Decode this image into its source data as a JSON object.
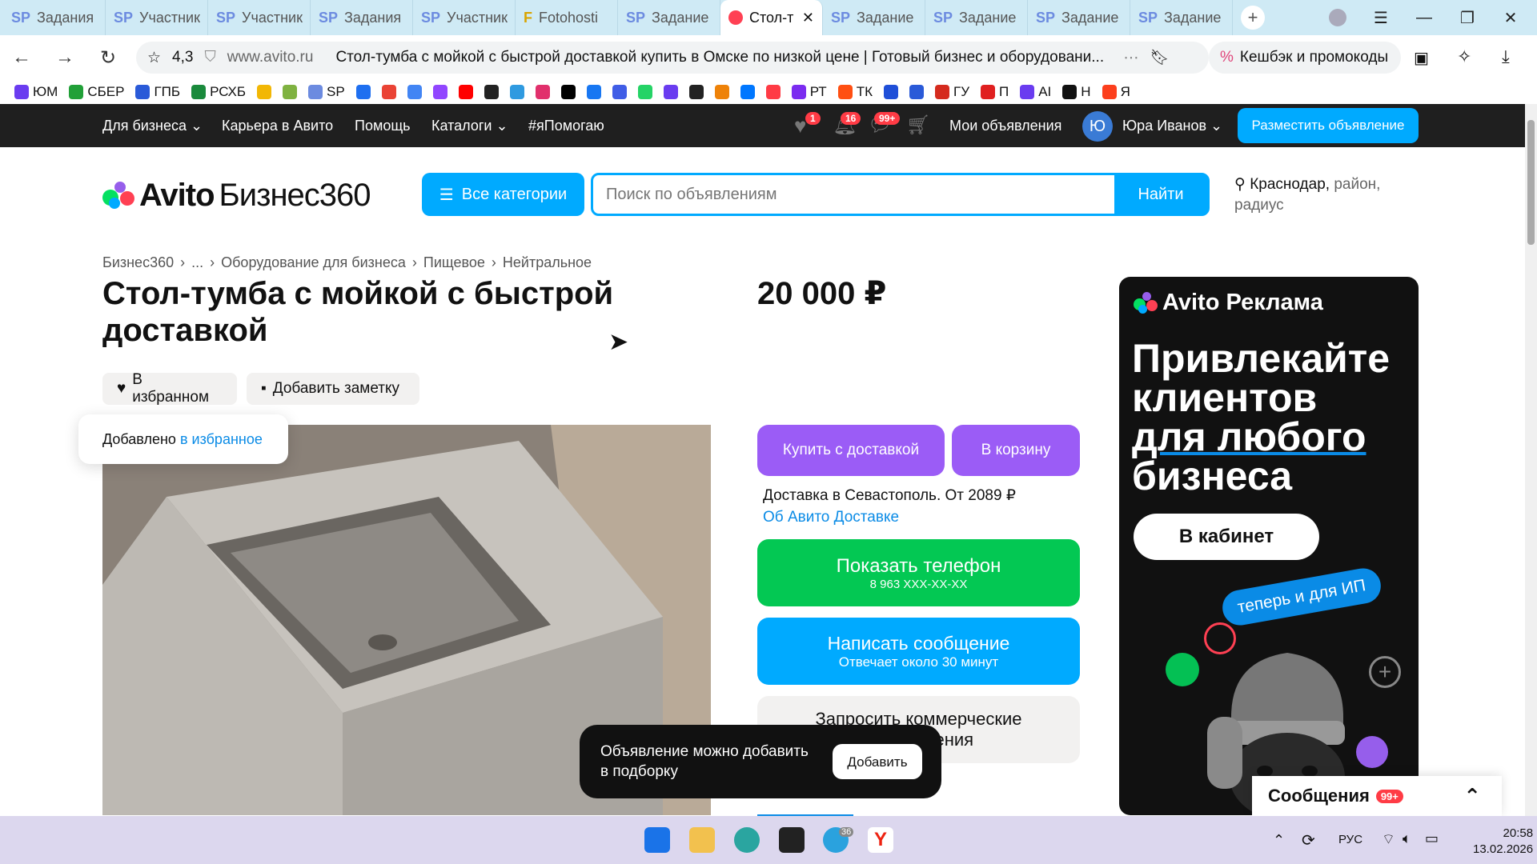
{
  "browser": {
    "tabs": [
      {
        "icon": "SP",
        "label": "Задания"
      },
      {
        "icon": "SP",
        "label": "Участник"
      },
      {
        "icon": "SP",
        "label": "Участник"
      },
      {
        "icon": "SP",
        "label": "Задания"
      },
      {
        "icon": "SP",
        "label": "Участник"
      },
      {
        "icon": "F",
        "label": "Fotohosti"
      },
      {
        "icon": "SP",
        "label": "Задание"
      },
      {
        "icon": "avito",
        "label": "Стол-т",
        "active": true
      },
      {
        "icon": "SP",
        "label": "Задание"
      },
      {
        "icon": "SP",
        "label": "Задание"
      },
      {
        "icon": "SP",
        "label": "Задание"
      },
      {
        "icon": "SP",
        "label": "Задание"
      }
    ],
    "rating": "4,3",
    "host": "www.avito.ru",
    "page_title": "Стол-тумба с мойкой с быстрой доставкой купить в Омске по низкой цене | Готовый бизнес и оборудовани...",
    "cashback": "Кешбэк и промокоды",
    "bookmarks": [
      {
        "label": "ЮМ",
        "color": "#6a3cf0"
      },
      {
        "label": "СБЕР",
        "color": "#21a038"
      },
      {
        "label": "ГПБ",
        "color": "#2a5ad8"
      },
      {
        "label": "РСХБ",
        "color": "#1a8a3c"
      },
      {
        "label": "",
        "color": "#f2b705"
      },
      {
        "label": "",
        "color": "#7fb241"
      },
      {
        "label": "SP",
        "color": "#6c8be0"
      },
      {
        "label": "",
        "color": "#1e6ff0"
      },
      {
        "label": "",
        "color": "#ea4335"
      },
      {
        "label": "",
        "color": "#4285f4"
      },
      {
        "label": "",
        "color": "#9146ff"
      },
      {
        "label": "",
        "color": "#ff0000"
      },
      {
        "label": "",
        "color": "#222222"
      },
      {
        "label": "",
        "color": "#2f9ae0"
      },
      {
        "label": "",
        "color": "#e1306c"
      },
      {
        "label": "",
        "color": "#000000"
      },
      {
        "label": "",
        "color": "#1877f2"
      },
      {
        "label": "",
        "color": "#405de6"
      },
      {
        "label": "",
        "color": "#25d366"
      },
      {
        "label": "",
        "color": "#6a3cf0"
      },
      {
        "label": "",
        "color": "#222222"
      },
      {
        "label": "",
        "color": "#ee8208"
      },
      {
        "label": "",
        "color": "#0077ff"
      },
      {
        "label": "",
        "color": "#ff3b45"
      },
      {
        "label": "РТ",
        "color": "#7b2cf0"
      },
      {
        "label": "ТК",
        "color": "#ff4f12"
      },
      {
        "label": "",
        "color": "#1f4fd8"
      },
      {
        "label": "",
        "color": "#2a5ad8"
      },
      {
        "label": "ГУ",
        "color": "#d52b1e"
      },
      {
        "label": "П",
        "color": "#e02020"
      },
      {
        "label": "AI",
        "color": "#6a3cf0"
      },
      {
        "label": "Н",
        "color": "#111111"
      },
      {
        "label": "Я",
        "color": "#fc3f1d"
      }
    ]
  },
  "topnav": {
    "items": [
      "Для бизнеса",
      "Карьера в Авито",
      "Помощь",
      "Каталоги",
      "#яПомогаю"
    ],
    "fav_badge": "1",
    "notif_badge": "16",
    "msg_badge": "99+",
    "my_ads": "Мои объявления",
    "avatar_letter": "Ю",
    "user_name": "Юра Иванов",
    "place_ad": "Разместить объявление"
  },
  "header": {
    "logo_avito": "Avito",
    "logo_business": "Бизнес360",
    "all_categories": "Все категории",
    "search_placeholder": "Поиск по объявлениям",
    "find": "Найти",
    "city": "Краснодар,",
    "location_rest": "район, радиус"
  },
  "breadcrumb": [
    "Бизнес360",
    "...",
    "Оборудование для бизнеса",
    "Пищевое",
    "Нейтральное"
  ],
  "listing": {
    "title": "Стол-тумба с мойкой с быстрой доставкой",
    "price": "20 000 ₽",
    "fav_label": "В избранном",
    "note_label": "Добавить заметку",
    "fav_toast_text": "Добавлено",
    "fav_toast_link": "в избранное"
  },
  "actions": {
    "buy_delivery": "Купить с доставкой",
    "to_cart": "В корзину",
    "delivery_text": "Доставка в Севастополь. От 2089 ₽",
    "delivery_link": "Об Авито Доставке",
    "show_phone": "Показать телефон",
    "phone_masked": "8 963 XXX-XX-XX",
    "write_message": "Написать сообщение",
    "reply_time": "Отвечает около 30 минут",
    "request_offer_1": "Запросить коммерческие",
    "request_offer_2": "предложения"
  },
  "ad": {
    "brand": "Avito Реклама",
    "line1": "Привлекайте",
    "line2": "клиентов",
    "line3": "для любого",
    "line4": "бизнеса",
    "cta": "В кабинет",
    "tag": "теперь и для ИП"
  },
  "snackbar": {
    "text": "Объявление можно добавить в подборку",
    "button": "Добавить"
  },
  "messages_widget": {
    "label": "Сообщения",
    "badge": "99+"
  },
  "taskbar": {
    "lang": "РУС",
    "time": "20:58",
    "date": "13.02.2026",
    "telegram_badge": "36"
  }
}
